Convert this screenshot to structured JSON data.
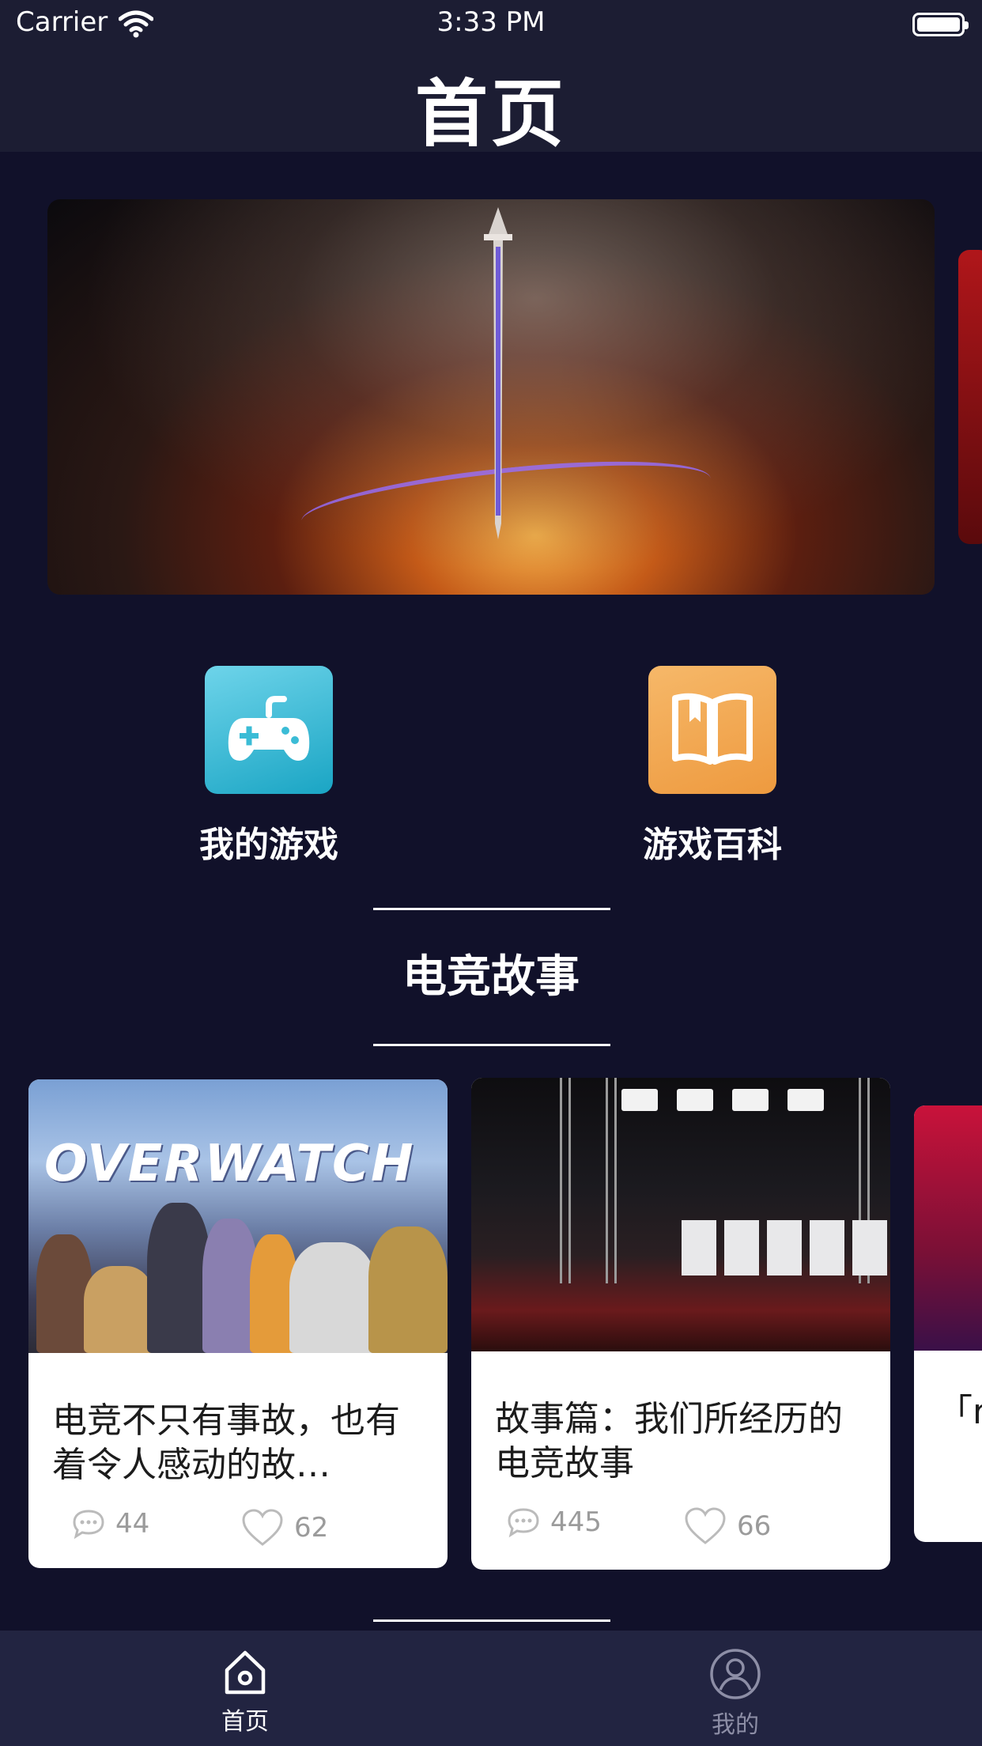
{
  "status_bar": {
    "carrier": "Carrier",
    "time": "3:33 PM"
  },
  "nav": {
    "title": "首页"
  },
  "banner": {
    "icon": "sword-art"
  },
  "entries": [
    {
      "label": "我的游戏",
      "icon": "gamepad-icon",
      "color": "#2bb6d1"
    },
    {
      "label": "游戏百科",
      "icon": "book-icon",
      "color": "#f2a552"
    }
  ],
  "section": {
    "title": "电竞故事"
  },
  "cards": [
    {
      "image_text": "OVERWATCH",
      "title": "电竞不只有事故，也有着令人感动的故…",
      "comments": "44",
      "likes": "62"
    },
    {
      "title": "故事篇：我们所经历的电竞故事",
      "comments": "445",
      "likes": "66"
    },
    {
      "title": "「r 解-",
      "comments": "",
      "likes": ""
    }
  ],
  "tabbar": {
    "items": [
      {
        "label": "首页",
        "icon": "home-icon",
        "active": true
      },
      {
        "label": "我的",
        "icon": "profile-icon",
        "active": false
      }
    ],
    "active_color": "#ffffff",
    "inactive_color": "#8d8ea6"
  }
}
